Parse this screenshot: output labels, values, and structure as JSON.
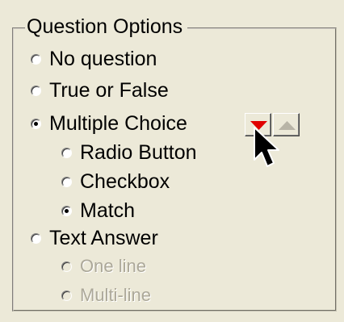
{
  "group": {
    "title": "Question Options"
  },
  "options": {
    "no_question": {
      "label": "No question",
      "checked": false,
      "enabled": true
    },
    "true_false": {
      "label": "True or False",
      "checked": false,
      "enabled": true
    },
    "multiple_choice": {
      "label": "Multiple Choice",
      "checked": true,
      "enabled": true
    },
    "radio_button": {
      "label": "Radio Button",
      "checked": false,
      "enabled": true
    },
    "checkbox": {
      "label": "Checkbox",
      "checked": false,
      "enabled": true
    },
    "match": {
      "label": "Match",
      "checked": true,
      "enabled": true
    },
    "text_answer": {
      "label": "Text Answer",
      "checked": false,
      "enabled": true
    },
    "one_line": {
      "label": "One line",
      "checked": false,
      "enabled": false
    },
    "multi_line": {
      "label": "Multi-line",
      "checked": false,
      "enabled": false
    }
  },
  "buttons": {
    "move_down": {
      "icon": "triangle-down-icon",
      "color": "#E00000"
    },
    "move_up": {
      "icon": "triangle-up-icon",
      "color": "#B8B4A6"
    }
  },
  "cursor": {
    "icon": "arrow-cursor-icon"
  }
}
